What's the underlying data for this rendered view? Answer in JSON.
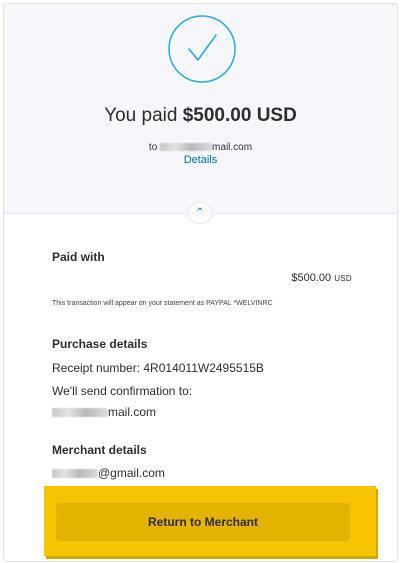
{
  "summary": {
    "headline_prefix": "You paid",
    "amount": "$500.00 USD",
    "recipient_prefix": "to",
    "recipient_suffix": "mail.com",
    "details_link": "Details"
  },
  "paid_with": {
    "title": "Paid with",
    "amount": "$500.00",
    "currency": "USD",
    "statement_note": "This transaction will appear on your statement as PAYPAL *WELVINRC"
  },
  "purchase": {
    "title": "Purchase details",
    "receipt": "Receipt number: 4R014011W2495515B",
    "confirmation": "We'll send confirmation to:",
    "email_suffix": "mail.com"
  },
  "merchant": {
    "title": "Merchant details",
    "email_suffix": "@gmail.com"
  },
  "actions": {
    "return_label": "Return to Merchant"
  },
  "colors": {
    "accent_blue": "#0070ba",
    "highlight_yellow": "#f6c400",
    "button_gold": "#e3b300",
    "check_blue": "#2fa8e2"
  },
  "icons": {
    "success": "checkmark-circle-icon",
    "toggle": "chevron-up-icon"
  }
}
